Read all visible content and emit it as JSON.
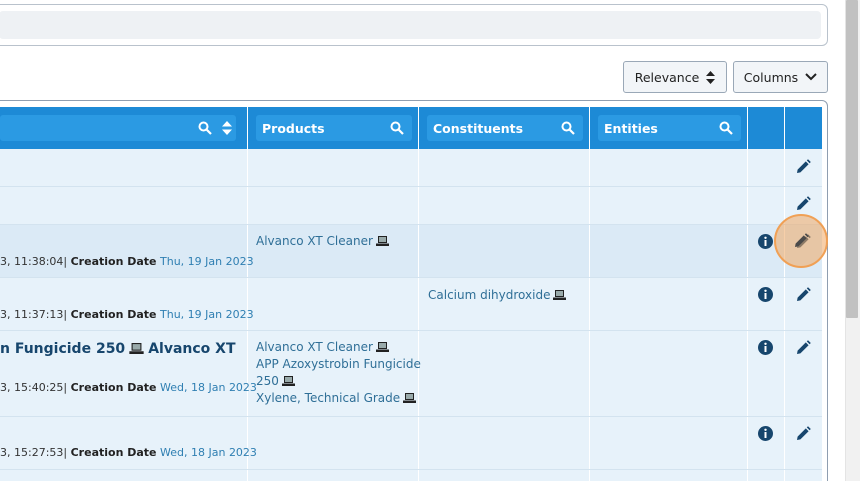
{
  "search": {
    "placeholder": ""
  },
  "toolbar": {
    "relevance_label": "Relevance",
    "columns_label": "Columns"
  },
  "table": {
    "headers": {
      "products": "Products",
      "constituents": "Constituents",
      "entities": "Entities"
    },
    "rows": [
      {
        "meta_left": "3, 11:38:04",
        "creation_label": "Creation Date",
        "creation_date": "Thu, 19 Jan 2023",
        "products": [
          "Alvanco XT Cleaner"
        ],
        "constituents": []
      },
      {
        "meta_left": "3, 11:37:13",
        "creation_label": "Creation Date",
        "creation_date": "Thu, 19 Jan 2023",
        "products": [],
        "constituents": [
          "Calcium dihydroxide"
        ]
      },
      {
        "title": "n Fungicide 250",
        "title2": "Alvanco XT",
        "meta_left": "3, 15:40:25",
        "creation_label": "Creation Date",
        "creation_date": "Wed, 18 Jan 2023",
        "products": [
          "Alvanco XT Cleaner",
          "APP Azoxystrobin Fungicide",
          "250",
          "Xylene, Technical Grade"
        ],
        "constituents": []
      },
      {
        "meta_left": "3, 15:27:53",
        "creation_label": "Creation Date",
        "creation_date": "Wed, 18 Jan 2023",
        "products": [],
        "constituents": []
      }
    ]
  },
  "colors": {
    "header": "#1d8ad6",
    "accent": "#17466d",
    "highlight": "#f0a055"
  },
  "icons": [
    "search-icon",
    "sort-icon",
    "laptop-icon",
    "info-icon",
    "pencil-icon",
    "chevron-down-icon"
  ]
}
